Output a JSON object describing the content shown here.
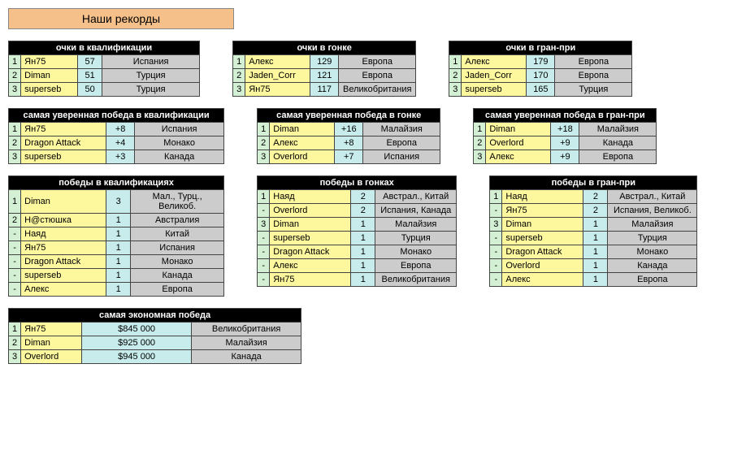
{
  "page_title": "Наши рекорды",
  "tables": [
    {
      "title": "очки в квалификации",
      "rows": [
        {
          "rank": "1",
          "name": "Ян75",
          "val": "57",
          "loc": "Испания"
        },
        {
          "rank": "2",
          "name": "Diman",
          "val": "51",
          "loc": "Турция"
        },
        {
          "rank": "3",
          "name": "superseb",
          "val": "50",
          "loc": "Турция"
        }
      ]
    },
    {
      "title": "очки в гонке",
      "rows": [
        {
          "rank": "1",
          "name": "Алекс",
          "val": "129",
          "loc": "Европа"
        },
        {
          "rank": "2",
          "name": "Jaden_Corr",
          "val": "121",
          "loc": "Европа"
        },
        {
          "rank": "3",
          "name": "Ян75",
          "val": "117",
          "loc": "Великобритания"
        }
      ]
    },
    {
      "title": "очки в гран-при",
      "rows": [
        {
          "rank": "1",
          "name": "Алекс",
          "val": "179",
          "loc": "Европа"
        },
        {
          "rank": "2",
          "name": "Jaden_Corr",
          "val": "170",
          "loc": "Европа"
        },
        {
          "rank": "3",
          "name": "superseb",
          "val": "165",
          "loc": "Турция"
        }
      ]
    },
    {
      "title": "самая уверенная победа в квалификации",
      "rows": [
        {
          "rank": "1",
          "name": "Ян75",
          "val": "+8",
          "loc": "Испания"
        },
        {
          "rank": "2",
          "name": "Dragon Attack",
          "val": "+4",
          "loc": "Монако"
        },
        {
          "rank": "3",
          "name": "superseb",
          "val": "+3",
          "loc": "Канада"
        }
      ]
    },
    {
      "title": "самая уверенная победа в гонке",
      "rows": [
        {
          "rank": "1",
          "name": "Diman",
          "val": "+16",
          "loc": "Малайзия"
        },
        {
          "rank": "2",
          "name": "Алекс",
          "val": "+8",
          "loc": "Европа"
        },
        {
          "rank": "3",
          "name": "Overlord",
          "val": "+7",
          "loc": "Испания"
        }
      ]
    },
    {
      "title": "самая уверенная победа в гран-при",
      "rows": [
        {
          "rank": "1",
          "name": "Diman",
          "val": "+18",
          "loc": "Малайзия"
        },
        {
          "rank": "2",
          "name": "Overlord",
          "val": "+9",
          "loc": "Канада"
        },
        {
          "rank": "3",
          "name": "Алекс",
          "val": "+9",
          "loc": "Европа"
        }
      ]
    },
    {
      "title": "победы в квалификациях",
      "rows": [
        {
          "rank": "1",
          "name": "Diman",
          "val": "3",
          "loc": "Мал., Турц., Великоб."
        },
        {
          "rank": "2",
          "name": "Н@стюшка",
          "val": "1",
          "loc": "Австралия"
        },
        {
          "rank": "-",
          "name": "Наяд",
          "val": "1",
          "loc": "Китай"
        },
        {
          "rank": "-",
          "name": "Ян75",
          "val": "1",
          "loc": "Испания"
        },
        {
          "rank": "-",
          "name": "Dragon Attack",
          "val": "1",
          "loc": "Монако"
        },
        {
          "rank": "-",
          "name": "superseb",
          "val": "1",
          "loc": "Канада"
        },
        {
          "rank": "-",
          "name": "Алекс",
          "val": "1",
          "loc": "Европа"
        }
      ]
    },
    {
      "title": "победы в гонках",
      "rows": [
        {
          "rank": "1",
          "name": "Наяд",
          "val": "2",
          "loc": "Австрал., Китай"
        },
        {
          "rank": "-",
          "name": "Overlord",
          "val": "2",
          "loc": "Испания, Канада"
        },
        {
          "rank": "3",
          "name": "Diman",
          "val": "1",
          "loc": "Малайзия"
        },
        {
          "rank": "-",
          "name": "superseb",
          "val": "1",
          "loc": "Турция"
        },
        {
          "rank": "-",
          "name": "Dragon Attack",
          "val": "1",
          "loc": "Монако"
        },
        {
          "rank": "-",
          "name": "Алекс",
          "val": "1",
          "loc": "Европа"
        },
        {
          "rank": "-",
          "name": "Ян75",
          "val": "1",
          "loc": "Великобритания"
        }
      ]
    },
    {
      "title": "победы в гран-при",
      "rows": [
        {
          "rank": "1",
          "name": "Наяд",
          "val": "2",
          "loc": "Австрал., Китай"
        },
        {
          "rank": "-",
          "name": "Ян75",
          "val": "2",
          "loc": "Испания, Великоб."
        },
        {
          "rank": "3",
          "name": "Diman",
          "val": "1",
          "loc": "Малайзия"
        },
        {
          "rank": "-",
          "name": "superseb",
          "val": "1",
          "loc": "Турция"
        },
        {
          "rank": "-",
          "name": "Dragon Attack",
          "val": "1",
          "loc": "Монако"
        },
        {
          "rank": "-",
          "name": "Overlord",
          "val": "1",
          "loc": "Канада"
        },
        {
          "rank": "-",
          "name": "Алекс",
          "val": "1",
          "loc": "Европа"
        }
      ]
    },
    {
      "title": "самая экономная победа",
      "rows": [
        {
          "rank": "1",
          "name": "Ян75",
          "val": "$845 000",
          "loc": "Великобритания"
        },
        {
          "rank": "2",
          "name": "Diman",
          "val": "$925 000",
          "loc": "Малайзия"
        },
        {
          "rank": "3",
          "name": "Overlord",
          "val": "$945 000",
          "loc": "Канада"
        }
      ]
    }
  ],
  "layout": {
    "groups": [
      [
        {
          "idx": 0,
          "nameW": 70,
          "valW": 30,
          "locW": 120
        },
        {
          "idx": 1,
          "nameW": 80,
          "valW": 35,
          "locW": 95
        },
        {
          "idx": 2,
          "nameW": 80,
          "valW": 35,
          "locW": 95
        }
      ],
      [
        {
          "idx": 3,
          "nameW": 105,
          "valW": 35,
          "locW": 110
        },
        {
          "idx": 4,
          "nameW": 80,
          "valW": 35,
          "locW": 95
        },
        {
          "idx": 5,
          "nameW": 80,
          "valW": 35,
          "locW": 95
        }
      ],
      [
        {
          "idx": 6,
          "nameW": 105,
          "valW": 30,
          "locW": 115
        },
        {
          "idx": 7,
          "nameW": 100,
          "valW": 30,
          "locW": 100
        },
        {
          "idx": 8,
          "nameW": 100,
          "valW": 30,
          "locW": 110
        }
      ],
      [
        {
          "idx": 9,
          "nameW": 75,
          "valW": 135,
          "locW": 135
        }
      ]
    ]
  }
}
